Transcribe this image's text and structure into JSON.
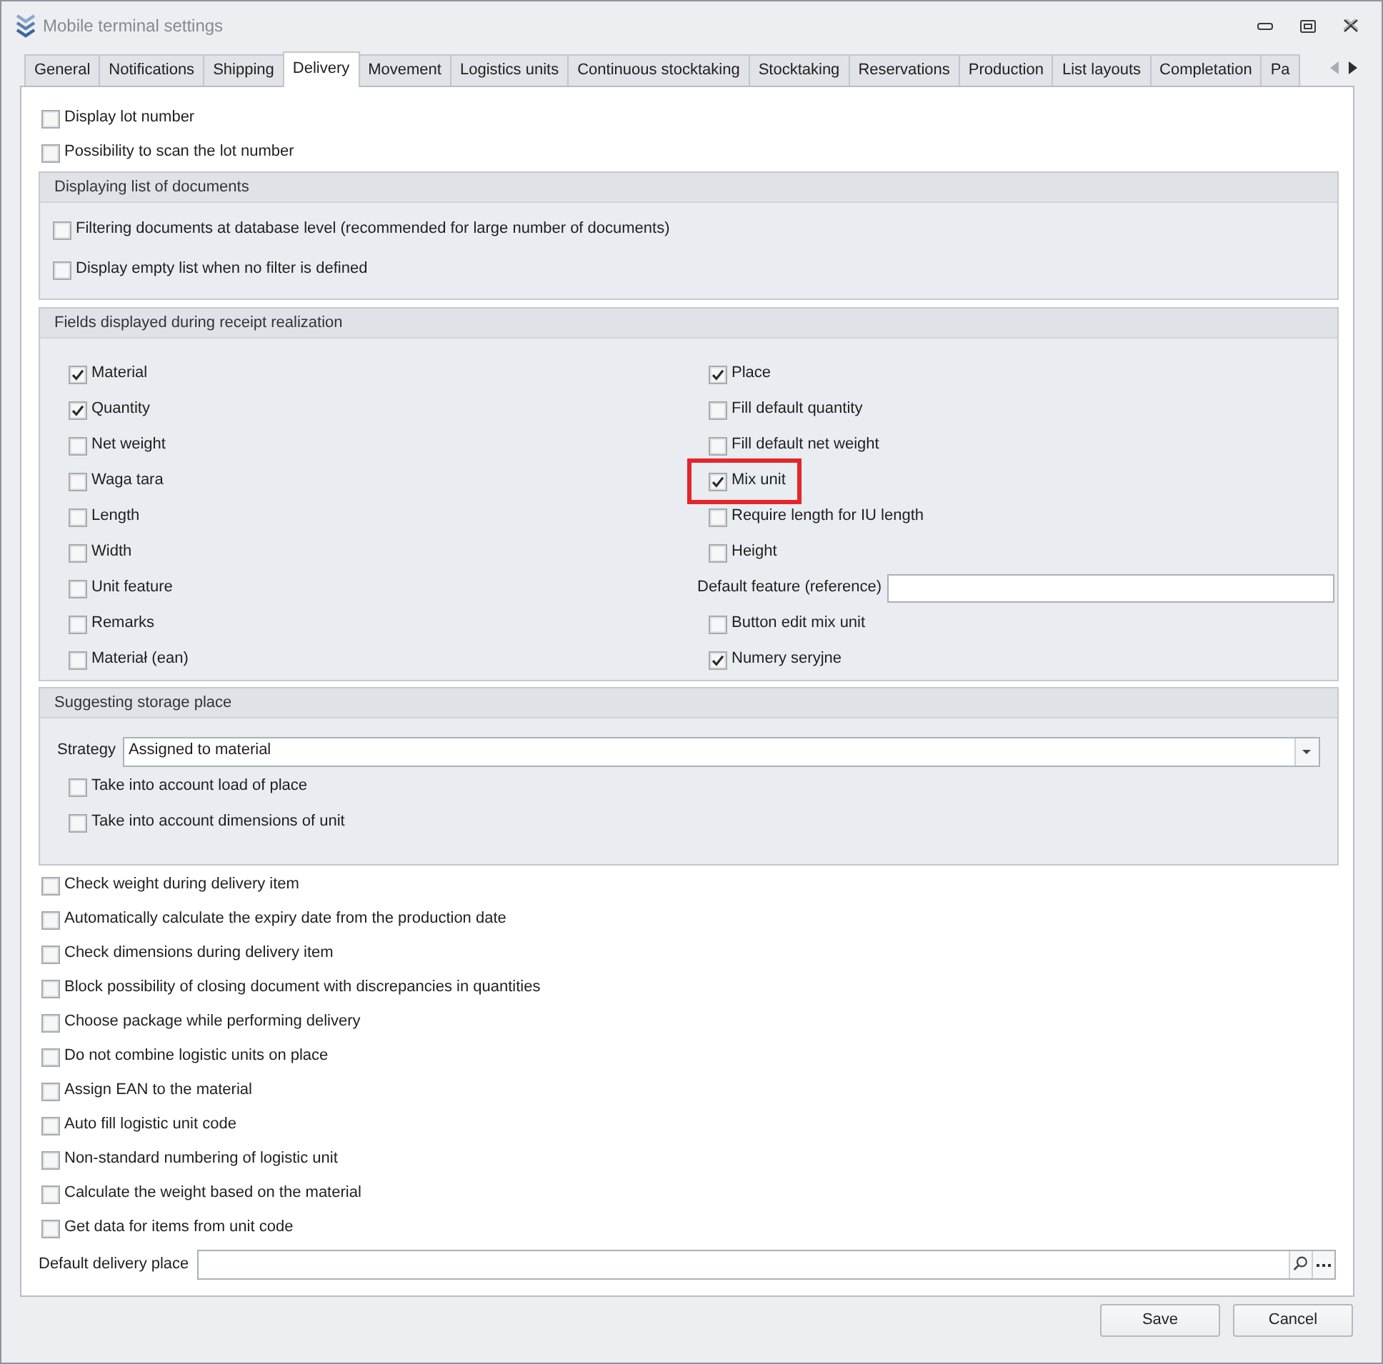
{
  "window": {
    "title": "Mobile terminal settings"
  },
  "tabs": [
    {
      "label": "General",
      "selected": false
    },
    {
      "label": "Notifications",
      "selected": false
    },
    {
      "label": "Shipping",
      "selected": false
    },
    {
      "label": "Delivery",
      "selected": true
    },
    {
      "label": "Movement",
      "selected": false
    },
    {
      "label": "Logistics units",
      "selected": false
    },
    {
      "label": "Continuous stocktaking",
      "selected": false
    },
    {
      "label": "Stocktaking",
      "selected": false
    },
    {
      "label": "Reservations",
      "selected": false
    },
    {
      "label": "Production",
      "selected": false
    },
    {
      "label": "List layouts",
      "selected": false
    },
    {
      "label": "Completation",
      "selected": false
    },
    {
      "label": "Pa",
      "selected": false
    }
  ],
  "tab_scroll": {
    "back_disabled": true,
    "forward_disabled": false
  },
  "top_options": [
    {
      "label": "Display lot number",
      "checked": false
    },
    {
      "label": "Possibility to scan the lot number",
      "checked": false
    }
  ],
  "document_list_group": {
    "title": "Displaying list of documents",
    "options": [
      {
        "label": "Filtering documents at database level (recommended for large number of documents)",
        "checked": false
      },
      {
        "label": "Display empty list when no filter is defined",
        "checked": false
      }
    ]
  },
  "receipt_fields_group": {
    "title": "Fields displayed during receipt realization",
    "left_column": [
      {
        "label": "Material",
        "checked": true
      },
      {
        "label": "Quantity",
        "checked": true
      },
      {
        "label": "Net weight",
        "checked": false
      },
      {
        "label": "Waga tara",
        "checked": false
      },
      {
        "label": "Length",
        "checked": false
      },
      {
        "label": "Width",
        "checked": false
      },
      {
        "label": "Unit feature",
        "checked": false
      },
      {
        "label": "Remarks",
        "checked": false
      },
      {
        "label": "Materiał (ean)",
        "checked": false
      }
    ],
    "right_column": [
      {
        "kind": "checkbox",
        "label": "Place",
        "checked": true
      },
      {
        "kind": "checkbox",
        "label": "Fill default quantity",
        "checked": false
      },
      {
        "kind": "checkbox",
        "label": "Fill default net weight",
        "checked": false
      },
      {
        "kind": "checkbox",
        "label": "Mix unit",
        "checked": true,
        "highlighted": true
      },
      {
        "kind": "checkbox",
        "label": "Require length for IU length",
        "checked": false
      },
      {
        "kind": "checkbox",
        "label": "Height",
        "checked": false
      },
      {
        "kind": "text_field",
        "label": "Default feature (reference)"
      },
      {
        "kind": "checkbox",
        "label": "Button edit mix unit",
        "checked": false
      },
      {
        "kind": "checkbox",
        "label": "Numery seryjne",
        "checked": true
      }
    ]
  },
  "storage_place_group": {
    "title": "Suggesting storage place",
    "strategy": {
      "label": "Strategy",
      "value": "Assigned to material"
    },
    "options": [
      {
        "label": "Take into account load of place",
        "checked": false
      },
      {
        "label": "Take into account dimensions of unit",
        "checked": false
      }
    ]
  },
  "delivery_options": [
    {
      "label": "Check weight during delivery item",
      "checked": false
    },
    {
      "label": "Automatically calculate the expiry date from the production date",
      "checked": false
    },
    {
      "label": "Check dimensions during delivery item",
      "checked": false
    },
    {
      "label": "Block possibility of closing document with discrepancies in quantities",
      "checked": false
    },
    {
      "label": "Choose package while performing delivery",
      "checked": false
    },
    {
      "label": "Do not combine logistic units on place",
      "checked": false
    },
    {
      "label": "Assign EAN to the material",
      "checked": false
    },
    {
      "label": "Auto fill logistic unit code",
      "checked": false
    },
    {
      "label": "Non-standard numbering of logistic unit",
      "checked": false
    },
    {
      "label": "Calculate the weight based on the material",
      "checked": false
    },
    {
      "label": "Get data for items from unit code",
      "checked": false
    }
  ],
  "default_delivery_place": {
    "label": "Default delivery place"
  },
  "buttons": [
    {
      "label": "Save"
    },
    {
      "label": "Cancel"
    }
  ]
}
